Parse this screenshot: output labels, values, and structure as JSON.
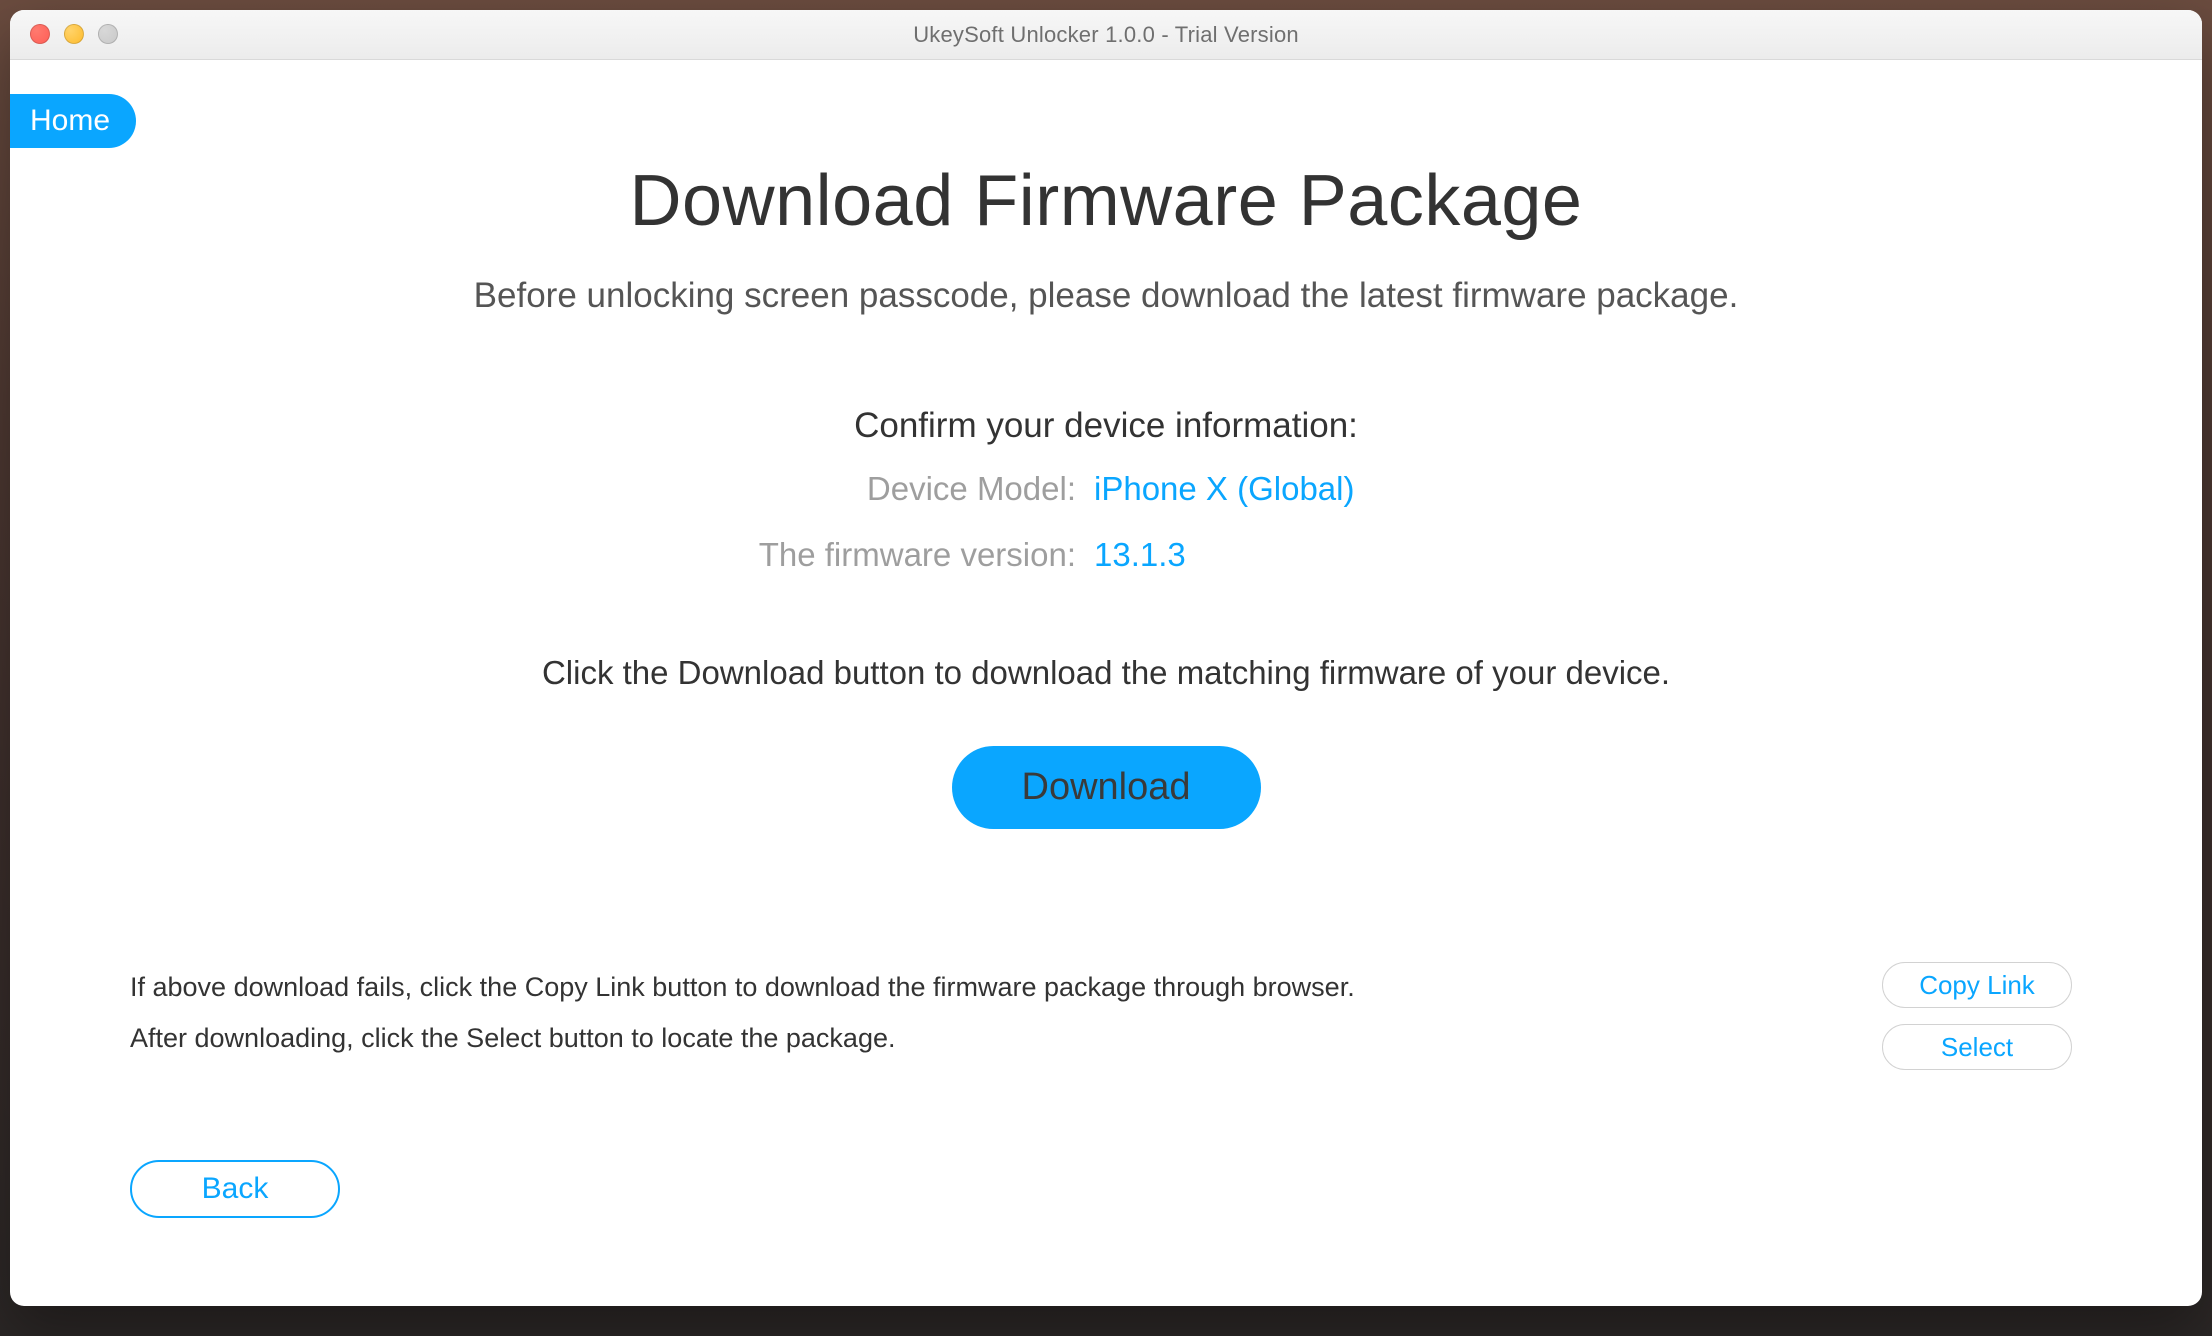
{
  "window": {
    "title": "UkeySoft Unlocker 1.0.0 - Trial Version"
  },
  "nav": {
    "home": "Home"
  },
  "page": {
    "title": "Download Firmware Package",
    "subtitle": "Before unlocking screen passcode, please download the latest firmware package.",
    "confirm_heading": "Confirm your device information:",
    "device": {
      "model_label": "Device Model:",
      "model_value": "iPhone X (Global)",
      "fw_label": "The firmware version:",
      "fw_value": "13.1.3"
    },
    "download_hint": "Click the Download button to download the matching firmware of your device.",
    "download_label": "Download",
    "alt": {
      "line1": "If above download fails, click the Copy Link button to download the firmware package through browser.",
      "line2": "After downloading, click the Select button to locate the package.",
      "copy_link": "Copy Link",
      "select": "Select"
    },
    "back": "Back"
  }
}
